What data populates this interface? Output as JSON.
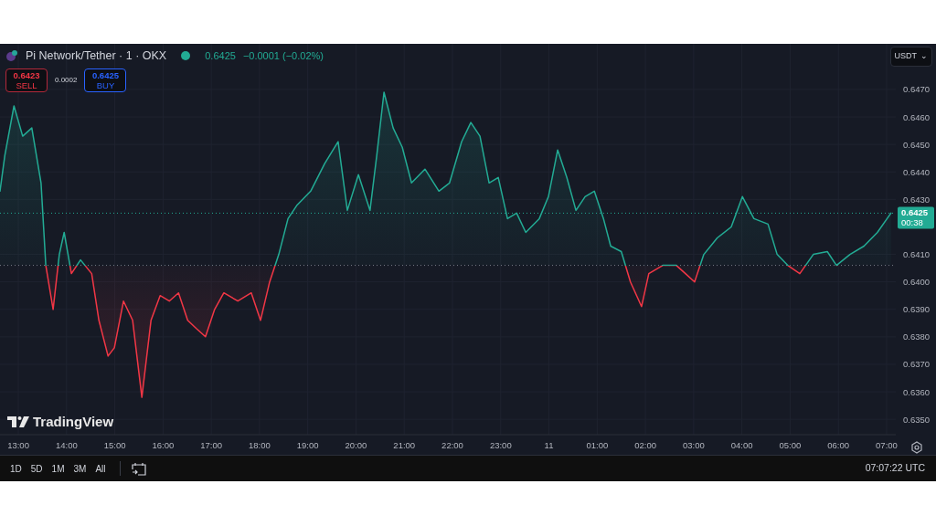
{
  "header": {
    "symbol": "Pi Network/Tether · 1 · OKX",
    "market_open": true,
    "last": "0.6425",
    "change": "−0.0001 (−0.02%)"
  },
  "trade": {
    "sell_price": "0.6423",
    "sell_label": "SELL",
    "spread": "0.0002",
    "buy_price": "0.6425",
    "buy_label": "BUY"
  },
  "currency": {
    "label": "USDT",
    "caret": "⌄"
  },
  "price_tag": {
    "price": "0.6425",
    "countdown": "00:38"
  },
  "brand": "TradingView",
  "chart_data": {
    "type": "area",
    "grid": true,
    "xlim": [
      12.62,
      31.19
    ],
    "ylim": [
      0.63444,
      0.64866
    ],
    "x": [
      12.62,
      12.72,
      12.91,
      13.09,
      13.28,
      13.47,
      13.57,
      13.72,
      13.85,
      13.95,
      14.1,
      14.29,
      14.52,
      14.67,
      14.86,
      14.99,
      15.18,
      15.37,
      15.56,
      15.75,
      15.94,
      16.13,
      16.32,
      16.51,
      16.69,
      16.88,
      17.07,
      17.26,
      17.55,
      17.83,
      18.02,
      18.21,
      18.4,
      18.59,
      18.78,
      19.06,
      19.35,
      19.63,
      19.82,
      20.05,
      20.29,
      20.43,
      20.58,
      20.77,
      20.96,
      21.15,
      21.43,
      21.72,
      21.94,
      22.19,
      22.38,
      22.57,
      22.76,
      22.95,
      23.14,
      23.33,
      23.52,
      23.8,
      23.99,
      24.18,
      24.37,
      24.56,
      24.75,
      24.94,
      25.13,
      25.28,
      25.5,
      25.69,
      25.92,
      26.07,
      26.36,
      26.64,
      26.83,
      27.02,
      27.21,
      27.49,
      27.78,
      28.01,
      28.25,
      28.54,
      28.73,
      28.95,
      29.2,
      29.48,
      29.77,
      29.96,
      30.24,
      30.53,
      30.81,
      31.09
    ],
    "values": [
      0.6433,
      0.6446,
      0.6464,
      0.6453,
      0.6456,
      0.6436,
      0.6406,
      0.639,
      0.641,
      0.6418,
      0.6403,
      0.6408,
      0.6403,
      0.6386,
      0.6373,
      0.6376,
      0.6393,
      0.6386,
      0.6358,
      0.6386,
      0.6395,
      0.6393,
      0.6396,
      0.6386,
      0.6383,
      0.638,
      0.639,
      0.6396,
      0.6393,
      0.6396,
      0.6386,
      0.64,
      0.641,
      0.6423,
      0.6428,
      0.6433,
      0.6443,
      0.6451,
      0.6426,
      0.6439,
      0.6426,
      0.6446,
      0.6469,
      0.6456,
      0.6449,
      0.6436,
      0.6441,
      0.6433,
      0.6436,
      0.6451,
      0.6458,
      0.6453,
      0.6436,
      0.6438,
      0.6423,
      0.6425,
      0.6418,
      0.6423,
      0.6431,
      0.6448,
      0.6438,
      0.6426,
      0.6431,
      0.6433,
      0.6423,
      0.6413,
      0.6411,
      0.64,
      0.6391,
      0.6403,
      0.6406,
      0.6406,
      0.6403,
      0.64,
      0.641,
      0.6416,
      0.642,
      0.6431,
      0.6423,
      0.6421,
      0.641,
      0.6406,
      0.6403,
      0.641,
      0.6411,
      0.6406,
      0.641,
      0.6413,
      0.6418,
      0.6425
    ],
    "yticks": [
      {
        "value": 0.635,
        "label": "0.6350"
      },
      {
        "value": 0.636,
        "label": "0.6360"
      },
      {
        "value": 0.637,
        "label": "0.6370"
      },
      {
        "value": 0.638,
        "label": "0.6380"
      },
      {
        "value": 0.639,
        "label": "0.6390"
      },
      {
        "value": 0.64,
        "label": "0.6400"
      },
      {
        "value": 0.641,
        "label": "0.6410"
      },
      {
        "value": 0.643,
        "label": "0.6430"
      },
      {
        "value": 0.644,
        "label": "0.6440"
      },
      {
        "value": 0.645,
        "label": "0.6450"
      },
      {
        "value": 0.646,
        "label": "0.6460"
      },
      {
        "value": 0.647,
        "label": "0.6470"
      }
    ],
    "xticks": [
      {
        "value": 13,
        "label": "13:00"
      },
      {
        "value": 14,
        "label": "14:00"
      },
      {
        "value": 15,
        "label": "15:00"
      },
      {
        "value": 16,
        "label": "16:00"
      },
      {
        "value": 17,
        "label": "17:00"
      },
      {
        "value": 18,
        "label": "18:00"
      },
      {
        "value": 19,
        "label": "19:00"
      },
      {
        "value": 20,
        "label": "20:00"
      },
      {
        "value": 21,
        "label": "21:00"
      },
      {
        "value": 22,
        "label": "22:00"
      },
      {
        "value": 23,
        "label": "23:00"
      }
    ],
    "ref_lines": [
      {
        "axis": "y",
        "value": 0.6406,
        "color": "#787b86"
      },
      {
        "axis": "y",
        "value": 0.6425,
        "color": "#22ab94"
      }
    ]
  },
  "next_day_ticks": [
    "11",
    "01:00",
    "02:00",
    "03:00",
    "04:00",
    "05:00",
    "06:00",
    "07:00"
  ],
  "ranges": [
    "1D",
    "5D",
    "1M",
    "3M",
    "All"
  ],
  "clock": "07:07:22 UTC"
}
